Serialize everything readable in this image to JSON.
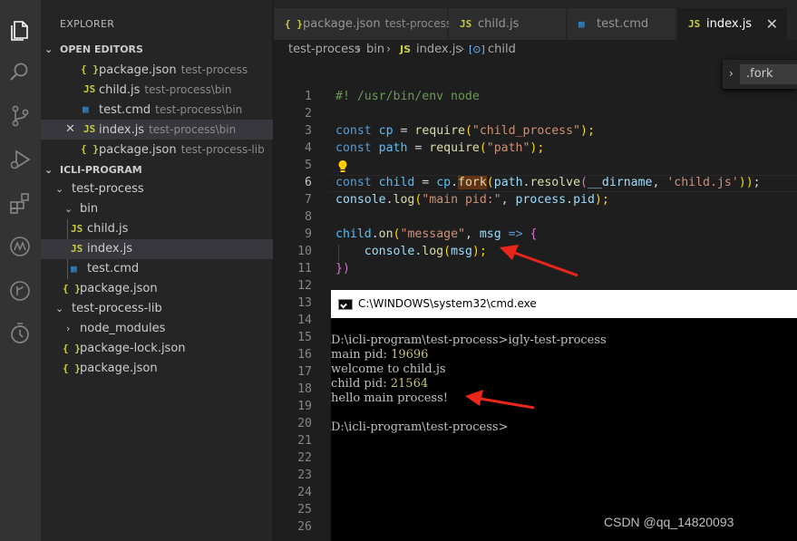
{
  "explorer": {
    "title": "EXPLORER",
    "open_editors_title": "OPEN EDITORS",
    "open_editors": [
      {
        "icon": "{ }",
        "name": "package.json",
        "desc": "test-process"
      },
      {
        "icon": "JS",
        "name": "child.js",
        "desc": "test-process\\bin"
      },
      {
        "icon": "▦",
        "name": "test.cmd",
        "desc": "test-process\\bin"
      },
      {
        "icon": "JS",
        "name": "index.js",
        "desc": "test-process\\bin",
        "close": "✕"
      },
      {
        "icon": "{ }",
        "name": "package.json",
        "desc": "test-process-lib"
      }
    ],
    "project_title": "ICLI-PROGRAM",
    "tree": [
      {
        "name": "test-process",
        "arrow": "⌄"
      },
      {
        "name": "bin",
        "arrow": "⌄"
      },
      {
        "icon": "JS",
        "name": "child.js"
      },
      {
        "icon": "JS",
        "name": "index.js"
      },
      {
        "icon": "▦",
        "name": "test.cmd"
      },
      {
        "icon": "{ }",
        "name": "package.json"
      },
      {
        "name": "test-process-lib",
        "arrow": "⌄"
      },
      {
        "name": "node_modules",
        "arrow": "›"
      },
      {
        "icon": "{ }",
        "name": "package-lock.json"
      },
      {
        "icon": "{ }",
        "name": "package.json"
      }
    ]
  },
  "tabs": [
    {
      "icon": "{ }",
      "label": "package.json",
      "desc": "test-process"
    },
    {
      "icon": "JS",
      "label": "child.js"
    },
    {
      "icon": "▦",
      "label": "test.cmd"
    },
    {
      "icon": "JS",
      "label": "index.js",
      "close": "✕"
    }
  ],
  "breadcrumb": {
    "part1": "test-process",
    "sep": "›",
    "part2": "bin",
    "icon": "JS",
    "part3": "index.js",
    "icon2": "[⊙]",
    "part4": "child"
  },
  "find": {
    "chevron": "›",
    "value": ".fork"
  },
  "editor": {
    "line_numbers": [
      "1",
      "2",
      "3",
      "4",
      "5",
      "6",
      "7",
      "8",
      "9",
      "10",
      "11",
      "12",
      "13",
      "14",
      "15",
      "16",
      "17",
      "18",
      "19",
      "20",
      "21",
      "22",
      "23",
      "24",
      "25",
      "26"
    ],
    "current_line": 6,
    "lines": {
      "l1": "#! /usr/bin/env node",
      "l3a": "const",
      "l3b": "cp",
      "l3c": " = ",
      "l3d": "require",
      "l3e": "(",
      "l3f": "\"child_process\"",
      "l3g": ");",
      "l4a": "const",
      "l4b": "path",
      "l4c": " = ",
      "l4d": "require",
      "l4e": "(",
      "l4f": "\"path\"",
      "l4g": ");",
      "l6a": "const",
      "l6b": "child",
      "l6c": " = ",
      "l6d": "cp",
      "l6e": ".",
      "l6f": "fork",
      "l6g": "(",
      "l6h": "path",
      "l6i": ".",
      "l6j": "resolve",
      "l6k": "(",
      "l6l": "__dirname",
      "l6m": ", ",
      "l6n": "'child.js'",
      "l6o": "))",
      "l6p": ";",
      "l7a": "console",
      "l7b": ".",
      "l7c": "log",
      "l7d": "(",
      "l7e": "\"main pid:\"",
      "l7f": ", ",
      "l7g": "process",
      "l7h": ".",
      "l7i": "pid",
      "l7j": ");",
      "l9a": "child",
      "l9b": ".",
      "l9c": "on",
      "l9d": "(",
      "l9e": "\"message\"",
      "l9f": ", ",
      "l9g": "msg",
      "l9h": " => ",
      "l9i": "{",
      "l10a": "    console",
      "l10b": ".",
      "l10c": "log",
      "l10d": "(",
      "l10e": "msg",
      "l10f": ");",
      "l11a": "})"
    }
  },
  "cmd": {
    "title": "C:\\WINDOWS\\system32\\cmd.exe",
    "lines": [
      {
        "text": "D:\\icli-program\\test-process>igly-test-process"
      },
      {
        "text": "main pid: ",
        "num": "19696"
      },
      {
        "text": "welcome to child.js"
      },
      {
        "text": "child pid: ",
        "num": "21564"
      },
      {
        "text": "hello main process!"
      },
      {
        "text": ""
      },
      {
        "text": "D:\\icli-program\\test-process>"
      }
    ]
  },
  "watermark": "CSDN @qq_14820093",
  "colors": {
    "arrow": "#e8261c",
    "accent": "#007acc"
  }
}
